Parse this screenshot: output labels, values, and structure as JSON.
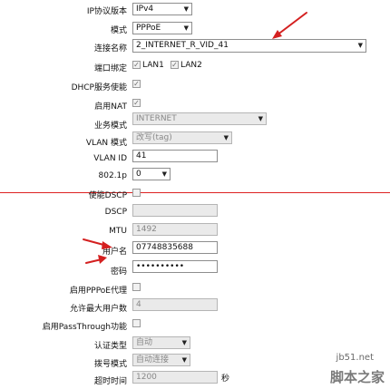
{
  "form": {
    "ip_protocol": {
      "label": "IP协议版本",
      "value": "IPv4"
    },
    "mode": {
      "label": "模式",
      "value": "PPPoE"
    },
    "connection_name": {
      "label": "连接名称",
      "value": "2_INTERNET_R_VID_41"
    },
    "port_binding": {
      "label": "端口绑定",
      "lan1": "LAN1",
      "lan2": "LAN2"
    },
    "dhcp": {
      "label": "DHCP服务使能"
    },
    "nat": {
      "label": "启用NAT"
    },
    "service_mode": {
      "label": "业务模式",
      "value": "INTERNET"
    },
    "vlan_mode": {
      "label": "VLAN 模式",
      "value": "改写(tag)"
    },
    "vlan_id": {
      "label": "VLAN ID",
      "value": "41"
    },
    "dot1p": {
      "label": "802.1p",
      "value": "0"
    },
    "dscp_enable": {
      "label": "使能DSCP"
    },
    "dscp": {
      "label": "DSCP",
      "value": ""
    },
    "mtu": {
      "label": "MTU",
      "value": "1492"
    },
    "username": {
      "label": "用户名",
      "value": "07748835688"
    },
    "password": {
      "label": "密码",
      "value": "••••••••••"
    },
    "pppoe_proxy": {
      "label": "启用PPPoE代理"
    },
    "max_users": {
      "label": "允许最大用户数",
      "value": "4"
    },
    "passthrough": {
      "label": "启用PassThrough功能"
    },
    "auth_type": {
      "label": "认证类型",
      "value": "自动"
    },
    "dial_mode": {
      "label": "拨号模式",
      "value": "自动连接"
    },
    "timeout": {
      "label": "超时时间",
      "value": "1200",
      "unit": "秒"
    }
  },
  "watermark": {
    "line1": "jb51.net",
    "line2": "脚本之家"
  },
  "colors": {
    "annotation": "#d42020"
  }
}
